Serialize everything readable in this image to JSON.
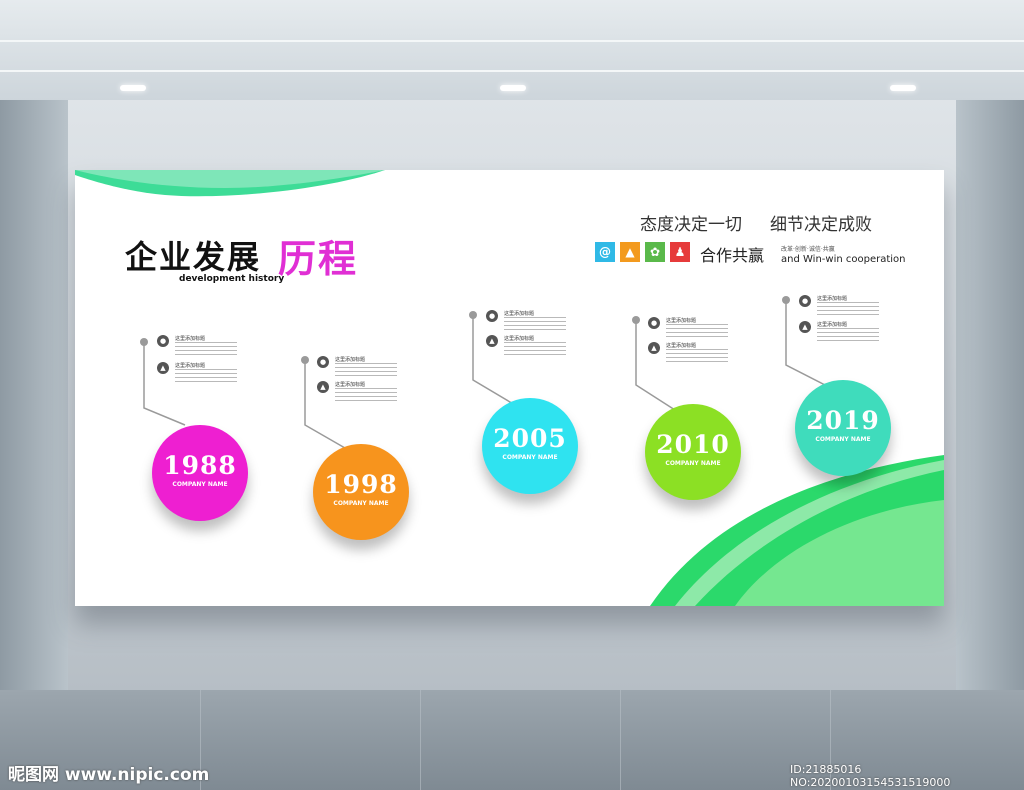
{
  "board": {
    "title": "企业发展",
    "title_accent": "历程",
    "subtitle": "development history",
    "slogan_left": "态度决定一切",
    "slogan_right": "细节决定成败",
    "motto": "合作共赢",
    "motto_small": "改革·创新·诚信·共赢",
    "motto_en": "and Win-win  cooperation",
    "icons": [
      {
        "name": "at-icon",
        "glyph": "@",
        "color": "#2fb9e6"
      },
      {
        "name": "chart-icon",
        "glyph": "▲",
        "color": "#f39a1e"
      },
      {
        "name": "gear-icon",
        "glyph": "✿",
        "color": "#5ab94a"
      },
      {
        "name": "person-icon",
        "glyph": "♟",
        "color": "#e63b3b"
      }
    ]
  },
  "timeline": [
    {
      "year": "1988",
      "company": "COMPANY NAME",
      "color": "#ee1fd1",
      "entries": [
        {
          "heading": "这里添加标题"
        },
        {
          "heading": "这里添加标题"
        }
      ]
    },
    {
      "year": "1998",
      "company": "COMPANY NAME",
      "color": "#f7941d",
      "entries": [
        {
          "heading": "这里添加标题"
        },
        {
          "heading": "这里添加标题"
        }
      ]
    },
    {
      "year": "2005",
      "company": "COMPANY NAME",
      "color": "#2fe3f0",
      "entries": [
        {
          "heading": "这里添加标题"
        },
        {
          "heading": "这里添加标题"
        }
      ]
    },
    {
      "year": "2010",
      "company": "COMPANY NAME",
      "color": "#8ce024",
      "entries": [
        {
          "heading": "这里添加标题"
        },
        {
          "heading": "这里添加标题"
        }
      ]
    },
    {
      "year": "2019",
      "company": "COMPANY NAME",
      "color": "#3fdcbc",
      "entries": [
        {
          "heading": "这里添加标题"
        },
        {
          "heading": "这里添加标题"
        }
      ]
    }
  ],
  "watermark": {
    "left": "昵图网 www.nipic.com",
    "right": "ID:21885016 NO:20200103154531519000"
  }
}
